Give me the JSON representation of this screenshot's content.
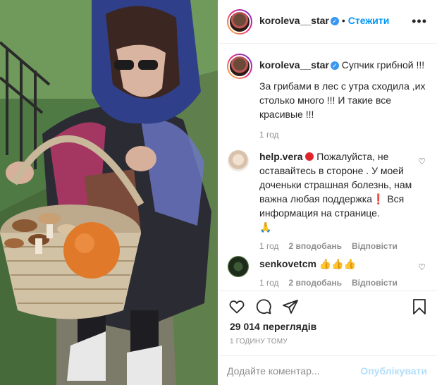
{
  "post": {
    "author": "koroleva__star",
    "follow_label": "Стежити",
    "separator": "•",
    "more_label": "•••",
    "caption_line1": "Супчик грибной !!!",
    "caption_body": "За грибами в лес с утра сходила ,их столько много !!! И такие все красивые !!!",
    "caption_time": "1 год"
  },
  "comments": [
    {
      "user": "help.vera",
      "text_before": "Пожалуйста, не оставайтесь в стороне . У моей доченьки страшная болезнь, нам важна любая поддержка",
      "text_after": " Вся информация на странице.",
      "emoji_end": "🙏",
      "time": "1 год",
      "likes": "2 вподобань",
      "reply": "Відповісти"
    },
    {
      "user": "senkovetcm",
      "text": "👍👍👍",
      "time": "1 год",
      "likes": "2 вподобань",
      "reply": "Відповісти"
    }
  ],
  "stats": {
    "views": "29 014 переглядів",
    "ago": "1 ГОДИНУ ТОМУ"
  },
  "comment_box": {
    "placeholder": "Додайте коментар...",
    "publish": "Опублікувати"
  },
  "colors": {
    "accent": "#0095f6",
    "publish_disabled": "#b2dffc",
    "muted": "#8e8e8e",
    "text": "#262626"
  },
  "icons": [
    "heart-icon",
    "comment-icon",
    "share-icon",
    "bookmark-icon",
    "verified-icon",
    "more-options-icon"
  ]
}
